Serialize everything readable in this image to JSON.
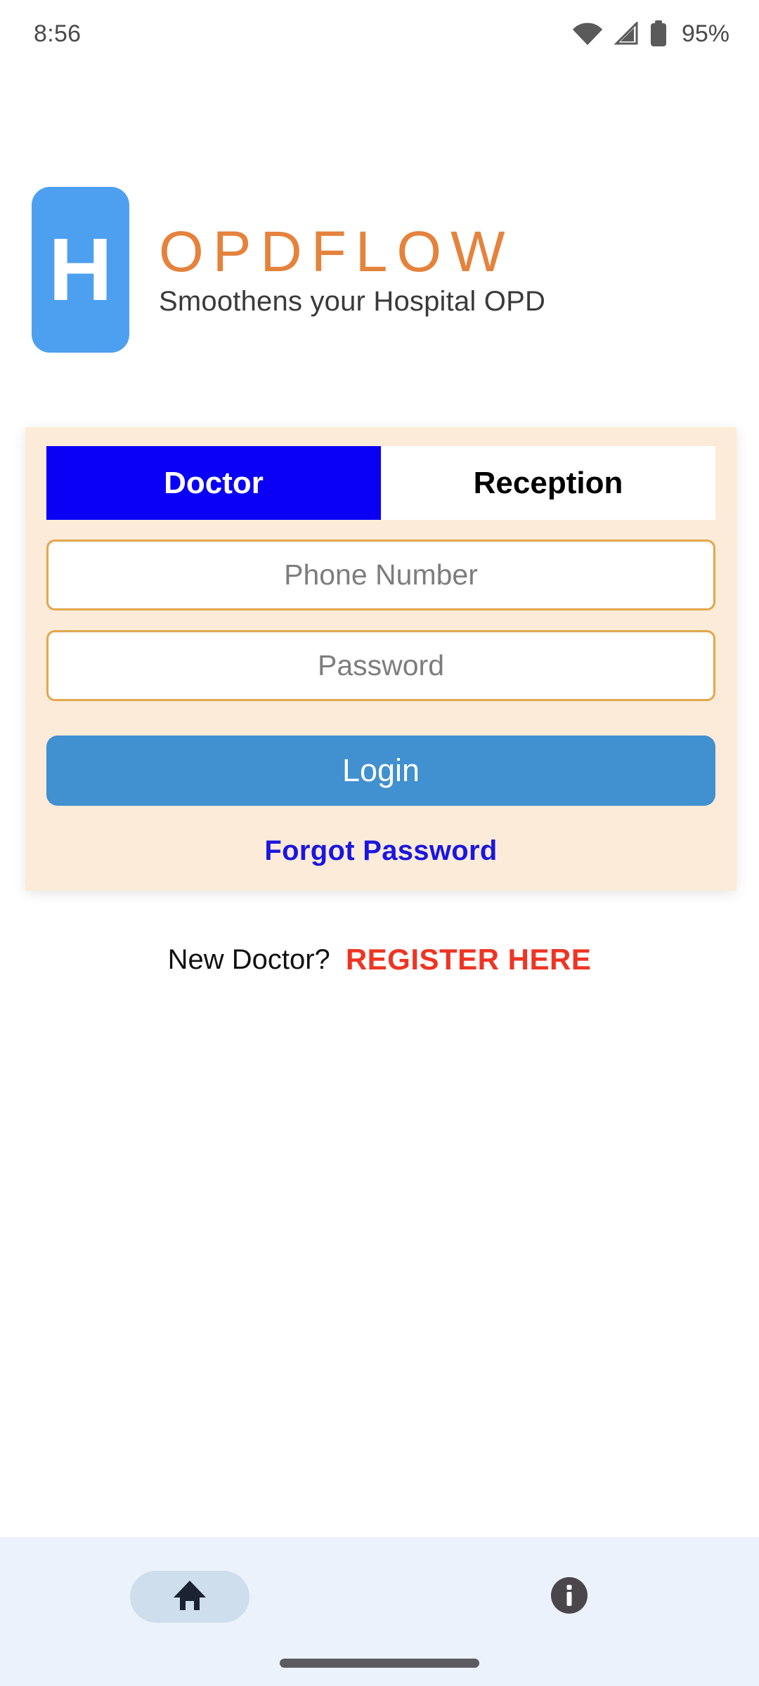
{
  "status_bar": {
    "time": "8:56",
    "battery_percent": "95%",
    "icons": [
      "wifi-icon",
      "cellular-signal-icon",
      "battery-icon"
    ]
  },
  "branding": {
    "logo_letter": "H",
    "logo_icon": "hospital-logo-icon",
    "brand_name": "OPDFLOW",
    "tagline": "Smoothens your Hospital OPD",
    "logo_color": "#4DA0F0",
    "brand_color": "#E5823C"
  },
  "login_card": {
    "background_color": "#FCEBD8",
    "tabs": [
      {
        "label": "Doctor",
        "active": true
      },
      {
        "label": "Reception",
        "active": false
      }
    ],
    "active_tab_color": "#0A00F5",
    "fields": [
      {
        "name": "phone",
        "placeholder": "Phone Number",
        "value": ""
      },
      {
        "name": "password",
        "placeholder": "Password",
        "value": ""
      }
    ],
    "login_button": {
      "label": "Login",
      "color": "#4190CF"
    },
    "forgot_password": {
      "label": "Forgot Password",
      "color": "#1A16DF"
    }
  },
  "register": {
    "question": "New Doctor?",
    "link_label": "REGISTER HERE",
    "link_color": "#EE3524"
  },
  "bottom_nav": {
    "background_color": "#EBF2FC",
    "items": [
      {
        "icon": "home-icon",
        "active": true
      },
      {
        "icon": "info-icon",
        "active": false
      }
    ]
  }
}
